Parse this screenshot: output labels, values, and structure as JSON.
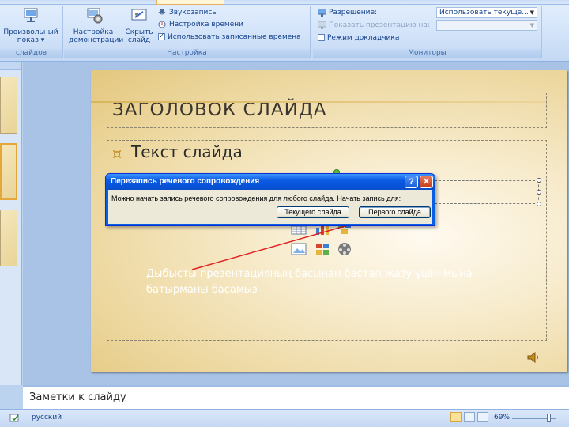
{
  "ribbon": {
    "groups": {
      "start": {
        "label": "слайдов",
        "button": "Произвольный\nпоказ ▾"
      },
      "setup": {
        "label": "Настройка",
        "buttons": [
          "Настройка\nдемонстрации",
          "Скрыть\nслайд"
        ],
        "items": [
          {
            "label": "Звукозапись",
            "checkbox": false
          },
          {
            "label": "Настройка времени",
            "checkbox": false
          },
          {
            "label": "Использовать записанные времена",
            "checkbox": true
          }
        ]
      },
      "monitors": {
        "label": "Мониторы",
        "resolution_label": "Разрешение:",
        "resolution_value": "Использовать текуще...",
        "show_on_label": "Показать презентацию на:",
        "show_on_value": "",
        "presenter_view_label": "Режим докладчика",
        "presenter_view_checked": false
      }
    }
  },
  "slide": {
    "title": "ЗАГОЛОВОК СЛАЙДА",
    "bullet": "¤",
    "body": "Текст слайда",
    "annotation": "Дыбысты презентацияның басынан бастап жазу үшін мына батырманы басамыз"
  },
  "dialog": {
    "title": "Перезапись речевого сопровождения",
    "help": "?",
    "close": "✕",
    "message": "Можно начать запись речевого сопровождения для любого слайда. Начать запись для:",
    "buttons": {
      "current": "Текущего слайда",
      "first": "Первого слайда"
    }
  },
  "notes": {
    "placeholder": "Заметки к слайду"
  },
  "status": {
    "language": "русский",
    "zoom": "69%"
  },
  "colors": {
    "annotation_arrow": "#e02020",
    "ribbon_bg": "#d3e4fa",
    "dialog_title": "#0b5be3"
  }
}
